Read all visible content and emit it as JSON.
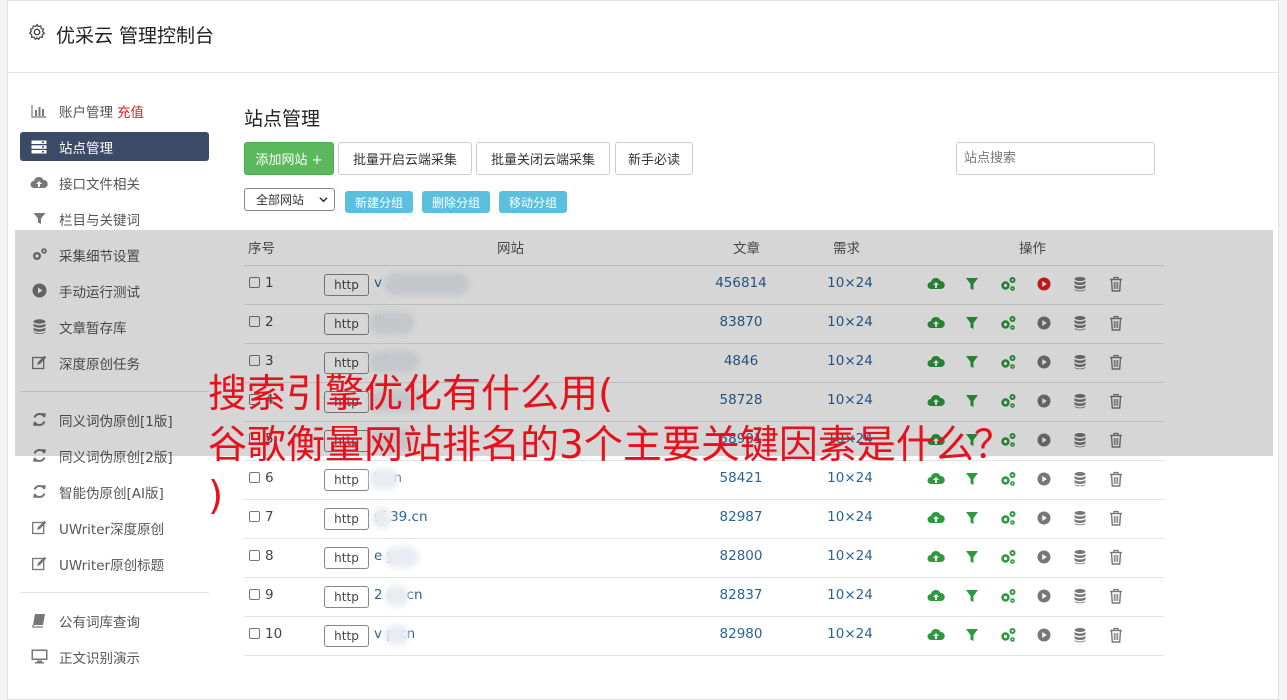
{
  "header": {
    "title": "优采云 管理控制台",
    "icon": "gear-icon"
  },
  "sidebar": {
    "group1": [
      {
        "label": "账户管理",
        "badge": "充值",
        "icon": "bar-chart-icon",
        "active": false
      },
      {
        "label": "站点管理",
        "icon": "server-icon",
        "active": true
      },
      {
        "label": "接口文件相关",
        "icon": "cloud-upload-icon",
        "active": false
      },
      {
        "label": "栏目与关键词",
        "icon": "filter-icon",
        "active": false
      },
      {
        "label": "采集细节设置",
        "icon": "gears-icon",
        "active": false
      },
      {
        "label": "手动运行测试",
        "icon": "play-circle-icon",
        "active": false
      },
      {
        "label": "文章暂存库",
        "icon": "database-icon",
        "active": false
      },
      {
        "label": "深度原创任务",
        "icon": "edit-icon",
        "active": false
      }
    ],
    "group2": [
      {
        "label": "同义词伪原创[1版]",
        "icon": "refresh-icon"
      },
      {
        "label": "同义词伪原创[2版]",
        "icon": "refresh-icon"
      },
      {
        "label": "智能伪原创[AI版]",
        "icon": "refresh-icon"
      },
      {
        "label": "UWriter深度原创",
        "icon": "edit-icon"
      },
      {
        "label": "UWriter原创标题",
        "icon": "edit-icon"
      }
    ],
    "group3": [
      {
        "label": "公有词库查询",
        "icon": "book-icon"
      },
      {
        "label": "正文识别演示",
        "icon": "monitor-icon"
      }
    ]
  },
  "main": {
    "title": "站点管理",
    "buttons": {
      "add_site": "添加网站 +",
      "batch_open": "批量开启云端采集",
      "batch_close": "批量关闭云端采集",
      "guide": "新手必读"
    },
    "search_placeholder": "站点搜索",
    "group_select": "全部网站",
    "group_buttons": {
      "new": "新建分组",
      "delete": "删除分组",
      "move": "移动分组"
    },
    "table": {
      "headers": {
        "index": "序号",
        "site": "网站",
        "articles": "文章",
        "demand": "需求",
        "ops": "操作"
      },
      "http_label": "http",
      "rows": [
        {
          "index": "1",
          "url": "v              .com",
          "articles": "456814",
          "demand": "10×24",
          "running": true
        },
        {
          "index": "2",
          "url": "       ilt.cn",
          "articles": "83870",
          "demand": "10×24",
          "running": false
        },
        {
          "index": "3",
          "url": "        ni.cn",
          "articles": "4846",
          "demand": "10×24",
          "running": false
        },
        {
          "index": "4",
          "url": "        pay.cn",
          "articles": "58728",
          "demand": "10×24",
          "running": false
        },
        {
          "index": "5",
          "url": "        e.cn",
          "articles": "58901",
          "demand": "10×24",
          "running": false
        },
        {
          "index": "6",
          "url": "       k.cn",
          "articles": "58421",
          "demand": "10×24",
          "running": false
        },
        {
          "index": "7",
          "url": "sf  39.cn",
          "articles": "82987",
          "demand": "10×24",
          "running": false
        },
        {
          "index": "8",
          "url": "e      y.cn",
          "articles": "82800",
          "demand": "10×24",
          "running": false
        },
        {
          "index": "9",
          "url": "2     az.cn",
          "articles": "82837",
          "demand": "10×24",
          "running": false
        },
        {
          "index": "10",
          "url": "v     p.cn",
          "articles": "82980",
          "demand": "10×24",
          "running": false
        }
      ]
    }
  },
  "overlay_headline": {
    "line1": "搜索引擎优化有什么用(",
    "line2": "谷歌衡量网站排名的3个主要关键因素是什么？",
    "line3": ")"
  },
  "colors": {
    "sidebar_active": "#3b4a66",
    "primary_link": "#2a6496",
    "success": "#5cb85c",
    "info": "#5bc0de",
    "headline": "#e8101b",
    "badge": "#e02020"
  }
}
